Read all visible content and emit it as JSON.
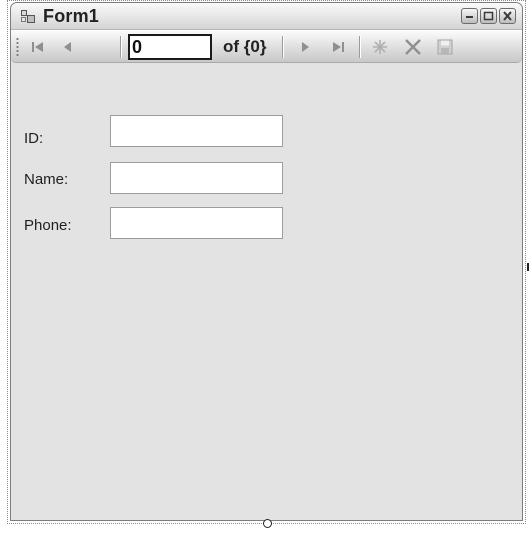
{
  "window": {
    "title": "Form1",
    "icons": {
      "app": "form-icon",
      "minimize": "minimize-icon",
      "maximize": "maximize-icon",
      "close": "close-icon"
    }
  },
  "navigator": {
    "position_value": "0",
    "count_label": "of {0}",
    "icons": [
      "move-first-icon",
      "move-previous-icon",
      "move-next-icon",
      "move-last-icon",
      "add-new-icon",
      "delete-icon",
      "save-icon"
    ]
  },
  "fields": [
    {
      "label": "ID:",
      "value": ""
    },
    {
      "label": "Name:",
      "value": ""
    },
    {
      "label": "Phone:",
      "value": ""
    }
  ]
}
